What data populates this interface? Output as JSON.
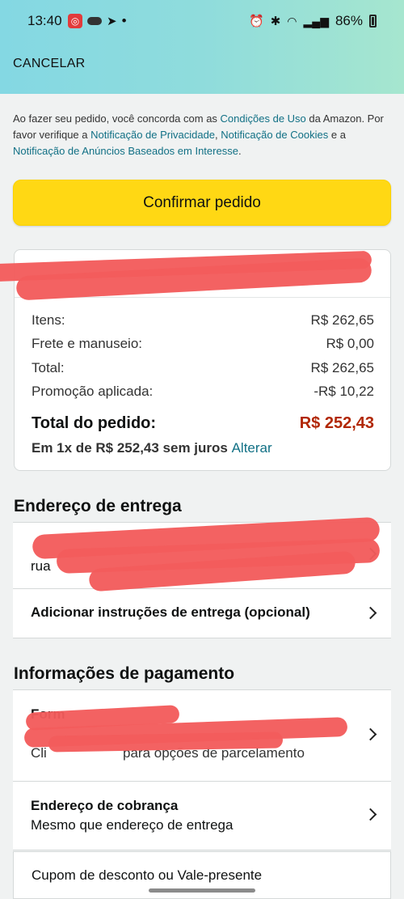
{
  "status_bar": {
    "time": "13:40",
    "battery": "86%",
    "dot": "•"
  },
  "header": {
    "cancel_label": "CANCELAR"
  },
  "legal": {
    "t1": "Ao fazer seu pedido, você concorda com as ",
    "l1": "Condições de Uso",
    "t2": " da Amazon. Por favor verifique a ",
    "l2": "Notificação de Privacidade",
    "t3": ", ",
    "l3": "Notificação de Cookies",
    "t4": " e a ",
    "l4": "Notificação de Anúncios Baseados em Interesse",
    "t5": "."
  },
  "confirm_label": "Confirmar pedido",
  "summary": {
    "rows": [
      {
        "label": "Itens:",
        "value": "R$ 262,65"
      },
      {
        "label": "Frete e manuseio:",
        "value": "R$ 0,00"
      },
      {
        "label": "Total:",
        "value": "R$ 262,65"
      },
      {
        "label": "Promoção aplicada:",
        "value": "-R$ 10,22"
      }
    ],
    "total_label": "Total do pedido:",
    "total_value": "R$ 252,43",
    "installments": "Em 1x de R$ 252,43 sem juros ",
    "change_link": "Alterar"
  },
  "shipping": {
    "title": "Endereço de entrega",
    "address_partial": "rua",
    "instructions_label": "Adicionar instruções de entrega (opcional)"
  },
  "payment": {
    "title": "Informações de pagamento",
    "method_partial": "Form",
    "installment_hint_partial": "Cli",
    "installment_hint_tail": "para opções de parcelamento",
    "billing_title": "Endereço de cobrança",
    "billing_value": "Mesmo que endereço de entrega",
    "coupon_label": "Cupom de desconto ou Vale-presente"
  },
  "colors": {
    "accent_yellow": "#ffd814",
    "price_red": "#b12704",
    "link_teal": "#117085",
    "redaction": "#f25c5c"
  }
}
